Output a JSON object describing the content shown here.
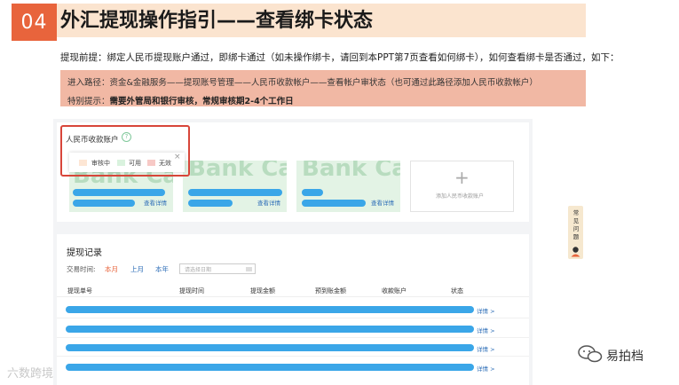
{
  "header": {
    "number": "04",
    "title": "外汇提现操作指引——查看绑卡状态"
  },
  "premise": "提现前提：绑定人民币提现账户通过，即绑卡通过（如未操作绑卡，请回到本PPT第7页查看如何绑卡），如何查看绑卡是否通过，如下：",
  "note": {
    "path": "进入路径：资金&金融服务——提现账号管理——人民币收款帐户——查看帐户审状态（也可通过此路径添加人民币收款帐户）",
    "tip_label": "特别提示：",
    "tip_text": "需要外管局和银行审核，常规审核期2-4个工作日"
  },
  "accounts": {
    "title": "人民币收款账户",
    "help": "?",
    "legend": {
      "reviewing": "审核中",
      "available": "可用",
      "invalid": "无效",
      "close": "×"
    },
    "card_watermark": "Bank Ca",
    "detail_link": "查看详情",
    "add_label": "添加人民币收款账户",
    "add_plus": "+"
  },
  "records": {
    "title": "提现记录",
    "time_label": "交易时间:",
    "filters": [
      "本月",
      "上月",
      "本年"
    ],
    "date_placeholder": "请选择日期",
    "columns": [
      "提现单号",
      "提现时间",
      "提现金额",
      "预到账金额",
      "收款账户",
      "状态"
    ],
    "row_link": "详情 >"
  },
  "side_tab": {
    "text": "常见问题"
  },
  "watermarks": {
    "left": "六数跨境",
    "right": "易拍档"
  },
  "colors": {
    "accent": "#e8643c",
    "band": "#f1b8a4",
    "title_bar": "#fbe4cf",
    "masked": "#3aa6e8",
    "card_green": "#e3f3e5",
    "highlight_border": "#d8463a"
  }
}
